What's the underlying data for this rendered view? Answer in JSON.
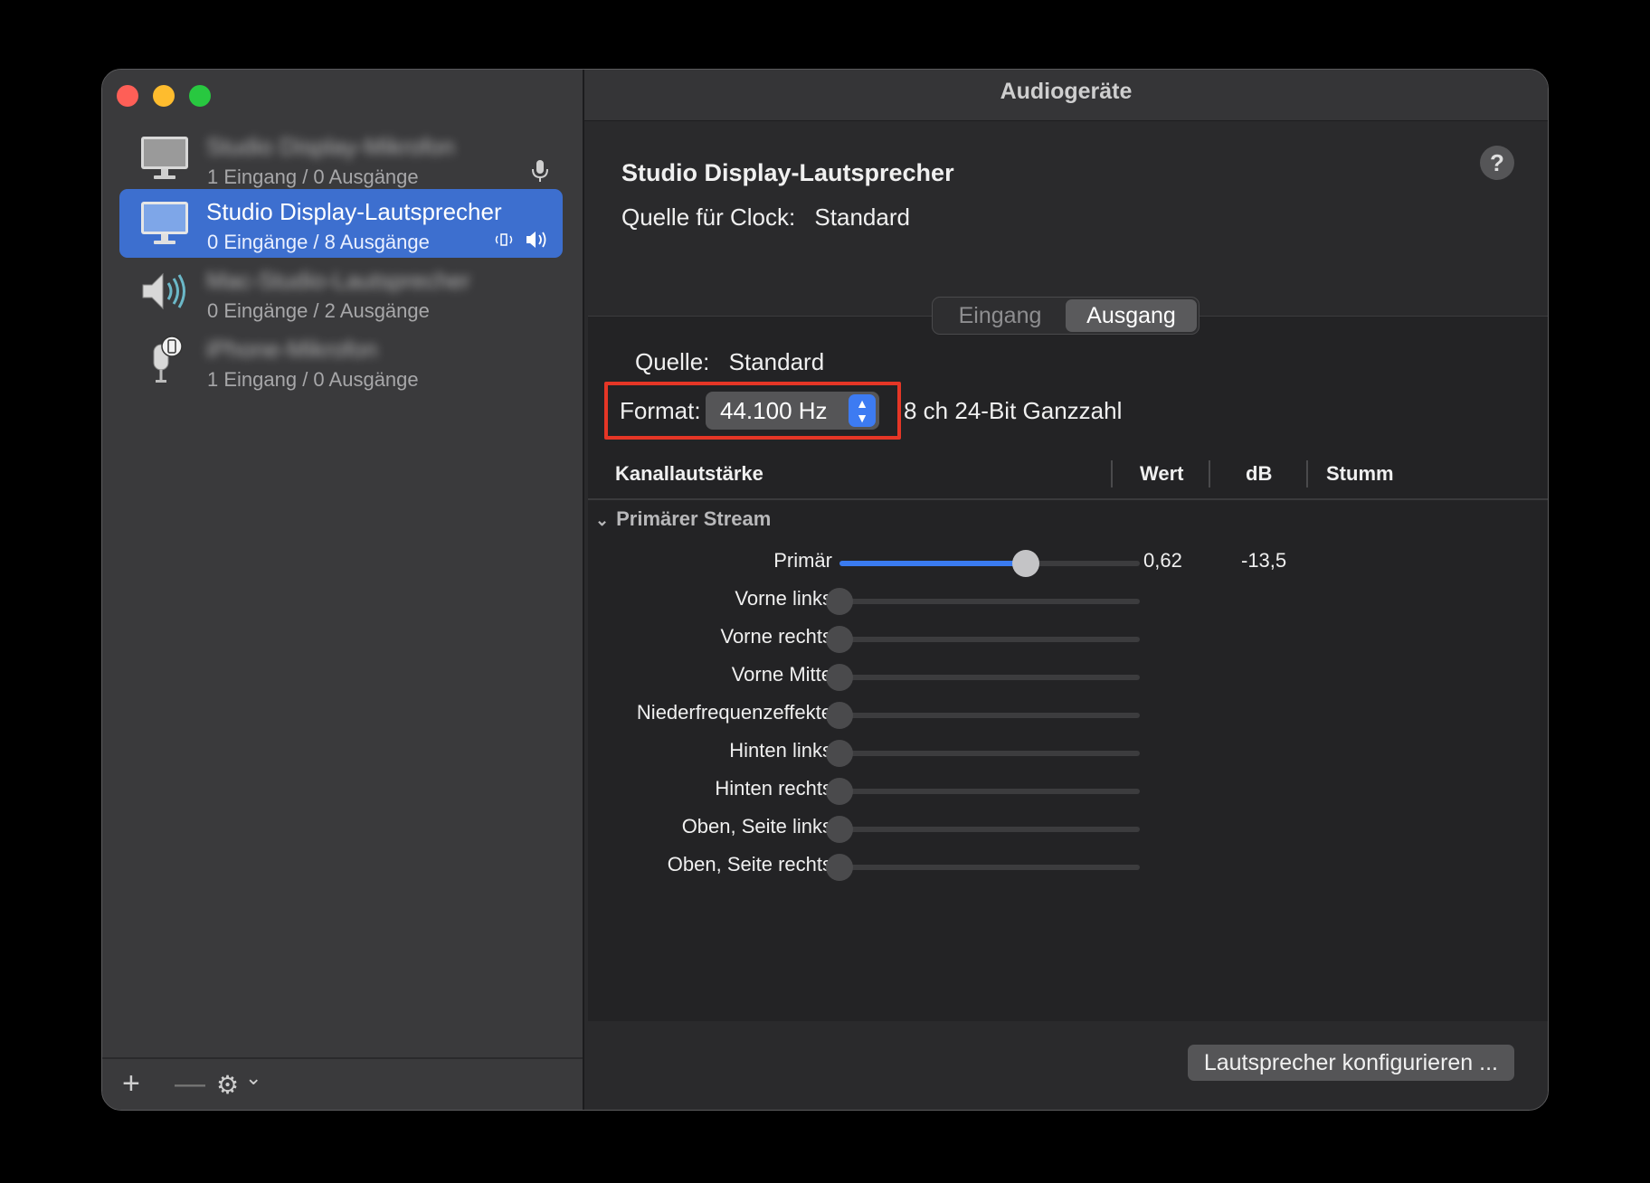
{
  "window": {
    "title": "Audiogeräte"
  },
  "sidebar": {
    "devices": [
      {
        "name": "Studio Display-Mikrofon",
        "io": "1 Eingang / 0 Ausgänge",
        "icon": "display-icon",
        "badge": "microphone-icon",
        "blurred": true
      },
      {
        "name": "Studio Display-Lautsprecher",
        "io": "0 Eingänge / 8 Ausgänge",
        "icon": "display-icon",
        "badge": "speaker-icons",
        "selected": true
      },
      {
        "name": "Mac-Studio-Lautsprecher",
        "io": "0 Eingänge / 2 Ausgänge",
        "icon": "speaker-icon",
        "blurred": true
      },
      {
        "name": "iPhone-Mikrofon",
        "io": "1 Eingang / 0 Ausgänge",
        "icon": "phone-mic-icon",
        "blurred": true
      }
    ],
    "toolbar": {
      "add": "+",
      "remove": "—",
      "gear": "⚙",
      "chevron": "⌄"
    }
  },
  "main": {
    "device_title": "Studio Display-Lautsprecher",
    "clock_label": "Quelle für Clock:",
    "clock_value": "Standard",
    "help": "?",
    "tabs": [
      {
        "label": "Eingang"
      },
      {
        "label": "Ausgang",
        "active": true
      }
    ],
    "source_label": "Quelle:",
    "source_value": "Standard",
    "format_label": "Format:",
    "format_value": "44.100 Hz",
    "format_extra": "8 ch 24-Bit Ganzzahl",
    "table": {
      "headers": [
        "Kanallautstärke",
        "Wert",
        "dB",
        "Stumm"
      ],
      "group": "Primärer Stream",
      "channels": [
        {
          "name": "Primär",
          "level": 0.62,
          "value": "0,62",
          "db": "-13,5",
          "active": true
        },
        {
          "name": "Vorne links",
          "level": 0
        },
        {
          "name": "Vorne rechts",
          "level": 0
        },
        {
          "name": "Vorne Mitte",
          "level": 0
        },
        {
          "name": "Niederfrequenzeffekte",
          "level": 0
        },
        {
          "name": "Hinten links",
          "level": 0
        },
        {
          "name": "Hinten rechts",
          "level": 0
        },
        {
          "name": "Oben, Seite links",
          "level": 0
        },
        {
          "name": "Oben, Seite rechts",
          "level": 0
        }
      ]
    },
    "configure_button": "Lautsprecher konfigurieren ..."
  },
  "colors": {
    "accent": "#3d6fcf",
    "highlight_box": "#e53626"
  }
}
